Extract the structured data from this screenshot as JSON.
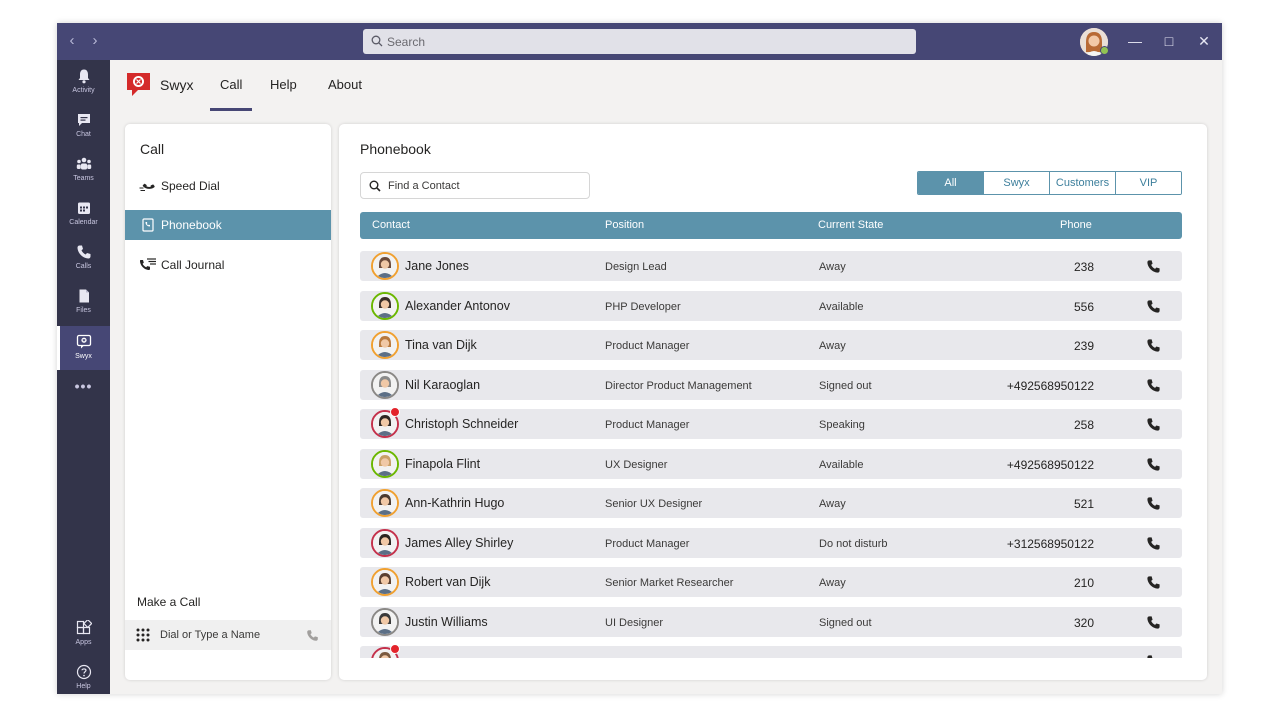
{
  "titlebar": {
    "search_placeholder": "Search"
  },
  "rail": {
    "items": [
      {
        "label": "Activity",
        "icon": "bell-icon"
      },
      {
        "label": "Chat",
        "icon": "chat-icon"
      },
      {
        "label": "Teams",
        "icon": "teams-icon"
      },
      {
        "label": "Calendar",
        "icon": "calendar-icon"
      },
      {
        "label": "Calls",
        "icon": "phone-icon"
      },
      {
        "label": "Files",
        "icon": "file-icon"
      },
      {
        "label": "Swyx",
        "icon": "swyx-icon"
      }
    ],
    "more": "•••",
    "bottom": [
      {
        "label": "Apps",
        "icon": "apps-icon"
      },
      {
        "label": "Help",
        "icon": "help-icon"
      }
    ]
  },
  "app": {
    "name": "Swyx",
    "tabs": [
      "Call",
      "Help",
      "About"
    ]
  },
  "left_panel": {
    "title": "Call",
    "menu": [
      "Speed Dial",
      "Phonebook",
      "Call Journal"
    ],
    "make_call_title": "Make a Call",
    "dial_placeholder": "Dial or Type a Name"
  },
  "main": {
    "title": "Phonebook",
    "find_placeholder": "Find a Contact",
    "filters": [
      "All",
      "Swyx",
      "Customers",
      "VIP"
    ],
    "columns": [
      "Contact",
      "Position",
      "Current State",
      "Phone"
    ],
    "contacts": [
      {
        "name": "Jane Jones",
        "position": "Design Lead",
        "state": "Away",
        "phone": "238",
        "ring": "#f0a030"
      },
      {
        "name": "Alexander Antonov",
        "position": "PHP Developer",
        "state": "Available",
        "phone": "556",
        "ring": "#6bb700"
      },
      {
        "name": "Tina van Dijk",
        "position": "Product Manager",
        "state": "Away",
        "phone": "239",
        "ring": "#f0a030"
      },
      {
        "name": "Nil Karaoglan",
        "position": "Director Product Management",
        "state": "Signed out",
        "phone": "+492568950122",
        "ring": "#8a8886"
      },
      {
        "name": "Christoph Schneider",
        "position": "Product Manager",
        "state": "Speaking",
        "phone": "258",
        "ring": "#c4314b"
      },
      {
        "name": "Finapola Flint",
        "position": "UX Designer",
        "state": "Available",
        "phone": "+492568950122",
        "ring": "#6bb700"
      },
      {
        "name": "Ann-Kathrin Hugo",
        "position": "Senior UX Designer",
        "state": "Away",
        "phone": "521",
        "ring": "#f0a030"
      },
      {
        "name": "James Alley Shirley",
        "position": "Product Manager",
        "state": "Do not disturb",
        "phone": "+312568950122",
        "ring": "#c4314b"
      },
      {
        "name": "Robert van Dijk",
        "position": "Senior Market Researcher",
        "state": "Away",
        "phone": "210",
        "ring": "#f0a030"
      },
      {
        "name": "Justin Williams",
        "position": "UI Designer",
        "state": "Signed out",
        "phone": "320",
        "ring": "#8a8886"
      },
      {
        "name": "",
        "position": "",
        "state": "",
        "phone": "",
        "ring": "#c4314b"
      }
    ]
  },
  "colors": {
    "titlebar": "#464775",
    "rail": "#33344a",
    "accent": "#5c93ab"
  }
}
